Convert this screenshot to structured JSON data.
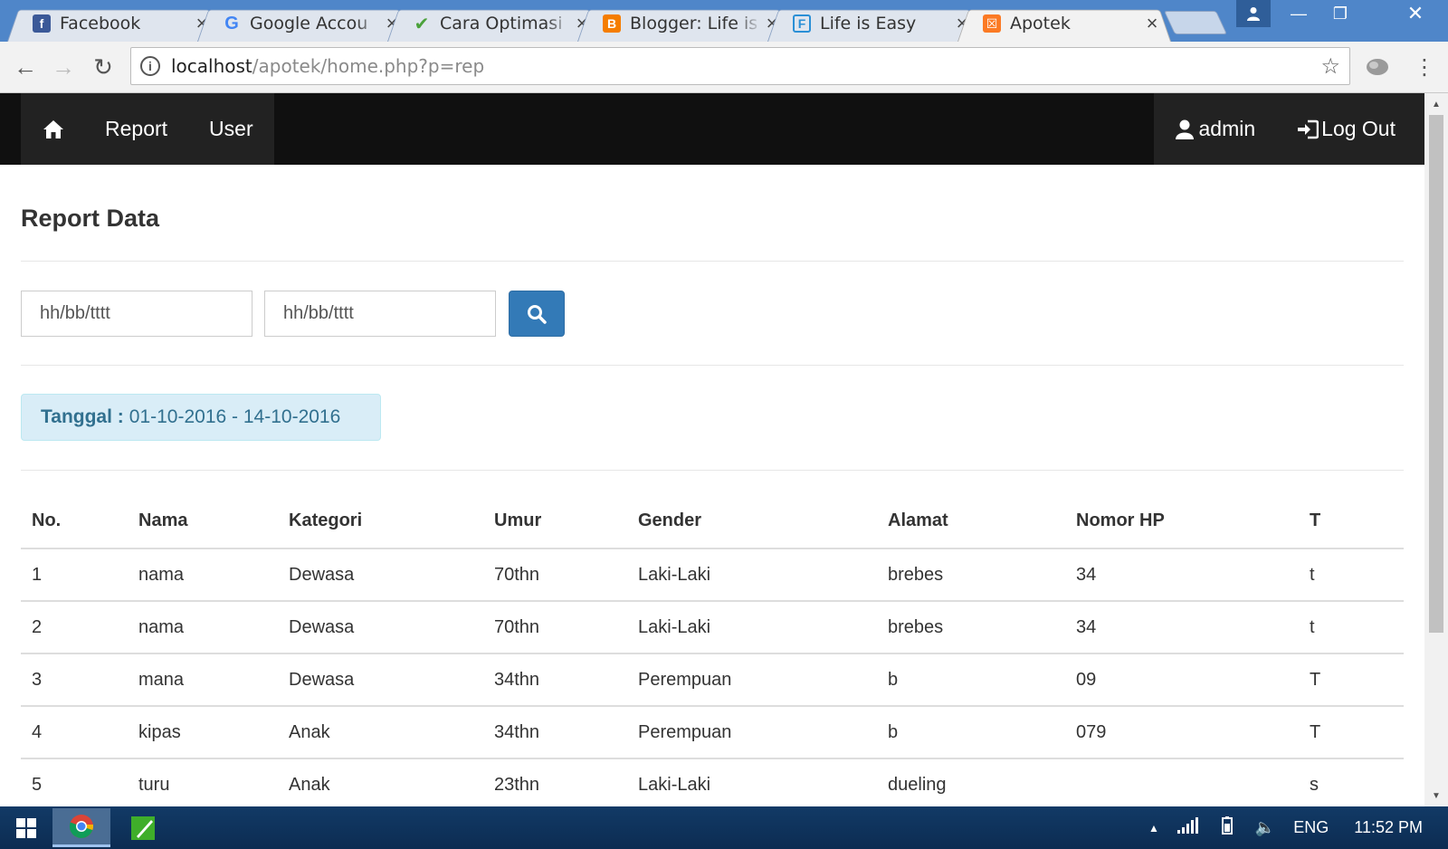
{
  "browser": {
    "tabs": [
      {
        "title": "Facebook",
        "icon": "facebook-icon",
        "active": false
      },
      {
        "title": "Google Accou",
        "icon": "google-icon",
        "active": false
      },
      {
        "title": "Cara Optimasi",
        "icon": "checkmark-icon",
        "active": false
      },
      {
        "title": "Blogger: Life is",
        "icon": "blogger-icon",
        "active": false
      },
      {
        "title": "Life is Easy",
        "icon": "forum-icon",
        "active": false
      },
      {
        "title": "Apotek",
        "icon": "xampp-icon",
        "active": true
      }
    ],
    "url_host": "localhost",
    "url_path": "/apotek/home.php?p=rep"
  },
  "navbar": {
    "left": [
      {
        "label": "Report"
      },
      {
        "label": "User"
      }
    ],
    "user_label": "admin",
    "logout_label": "Log Out"
  },
  "page": {
    "title": "Report Data",
    "date_from_placeholder": "hh/bb/tttt",
    "date_to_placeholder": "hh/bb/tttt",
    "alert_label": "Tanggal :",
    "alert_value": "01-10-2016 - 14-10-2016"
  },
  "table": {
    "headers": [
      "No.",
      "Nama",
      "Kategori",
      "Umur",
      "Gender",
      "Alamat",
      "Nomor HP",
      "T"
    ],
    "rows": [
      [
        "1",
        "nama",
        "Dewasa",
        "70thn",
        "Laki-Laki",
        "brebes",
        "34",
        "t"
      ],
      [
        "2",
        "nama",
        "Dewasa",
        "70thn",
        "Laki-Laki",
        "brebes",
        "34",
        "t"
      ],
      [
        "3",
        "mana",
        "Dewasa",
        "34thn",
        "Perempuan",
        "b",
        "09",
        "T"
      ],
      [
        "4",
        "kipas",
        "Anak",
        "34thn",
        "Perempuan",
        "b",
        "079",
        "T"
      ],
      [
        "5",
        "turu",
        "Anak",
        "23thn",
        "Laki-Laki",
        "dueling",
        "",
        "s"
      ]
    ]
  },
  "taskbar": {
    "language": "ENG",
    "time": "11:52 PM"
  },
  "colors": {
    "tabstrip": "#4f86c9",
    "navbar": "#222222",
    "primary": "#337ab7",
    "alert_bg": "#d9edf7",
    "alert_text": "#31708f"
  }
}
